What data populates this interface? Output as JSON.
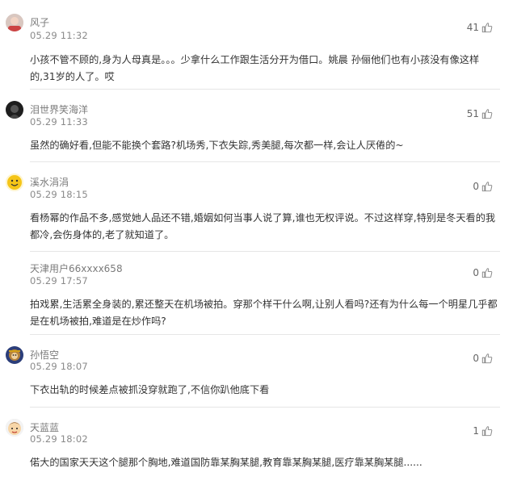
{
  "comments": [
    {
      "user": "风子",
      "time": "05.29 11:32",
      "likes": "41",
      "text": "小孩不管不顾的,身为人母真是。。。少拿什么工作跟生活分开为借口。姚晨 孙俪他们也有小孩没有像这样的,31岁的人了。哎",
      "avatar": "face-avatar"
    },
    {
      "user": "泪世界笑海洋",
      "time": "05.29 11:33",
      "likes": "51",
      "text": "虽然的确好看,但能不能换个套路?机场秀,下衣失踪,秀美腿,每次都一样,会让人厌倦的~",
      "avatar": "dark-avatar"
    },
    {
      "user": "溪水涓涓",
      "time": "05.29 18:15",
      "likes": "0",
      "text": "看杨幂的作品不多,感觉她人品还不错,婚姻如何当事人说了算,谁也无权评说。不过这样穿,特别是冬天看的我都冷,会伤身体的,老了就知道了。",
      "avatar": "yellow-avatar"
    },
    {
      "user": "天津用户66xxxx658",
      "time": "05.29 17:57",
      "likes": "0",
      "text": "拍戏累,生活累全身装的,累还整天在机场被拍。穿那个样干什么啊,让别人看吗?还有为什么每一个明星几乎都是在机场被拍,难道是在炒作吗?",
      "avatar": ""
    },
    {
      "user": "孙悟空",
      "time": "05.29 18:07",
      "likes": "0",
      "text": "下衣出轨的时候差点被抓没穿就跑了,不信你趴他底下看",
      "avatar": "monkey-avatar"
    },
    {
      "user": "天蓝蓝",
      "time": "05.29 18:02",
      "likes": "1",
      "text": "偌大的国家天天这个腿那个胸地,难道国防靠某胸某腿,教育靠某胸某腿,医疗靠某胸某腿......",
      "avatar": "cartoon-avatar"
    }
  ],
  "icons": {
    "like": "thumbs-up-icon"
  },
  "colors": {
    "divider": "#e6e6e6",
    "username": "#7b7b7b",
    "text": "#333333"
  }
}
